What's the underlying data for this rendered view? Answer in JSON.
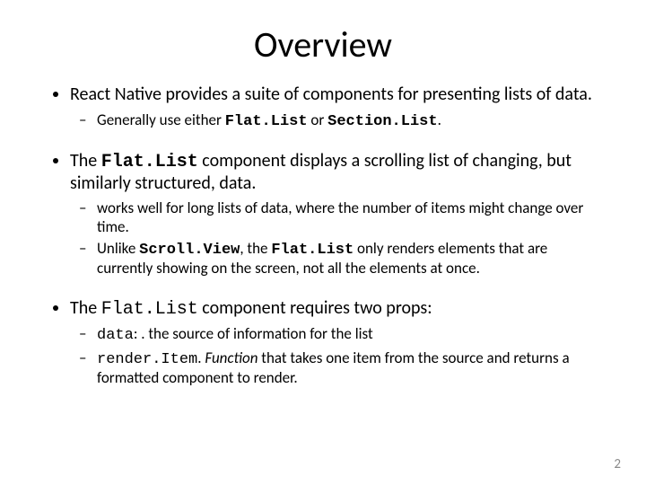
{
  "title": "Overview",
  "bullets": [
    {
      "text": "React Native provides a suite of components for presenting lists of data.",
      "sub": [
        {
          "pre": "Generally use either ",
          "code1": "Flat.List",
          "mid": " or ",
          "code2": "Section.List",
          "post": "."
        }
      ]
    },
    {
      "pre": "The ",
      "code": "Flat.List",
      "post": " component displays a scrolling list of changing, but similarly structured, data.",
      "sub": [
        {
          "text": "works well for long lists of data, where the number of items might change over time."
        },
        {
          "pre": "Unlike ",
          "code1": "Scroll.View",
          "mid": ", the ",
          "code2": "Flat.List",
          "post": " only renders elements that are currently showing on the screen, not all the elements at once."
        }
      ]
    },
    {
      "pre": "The ",
      "code": "Flat.List",
      "post": " component requires two props:",
      "sub": [
        {
          "code": "data",
          "sep": ": . ",
          "post": "the source of information for the list"
        },
        {
          "code": " render.Item",
          "sep": ". ",
          "em": "Function",
          "post": " that takes one item from the source and returns a formatted component to render."
        }
      ]
    }
  ],
  "page": "2"
}
